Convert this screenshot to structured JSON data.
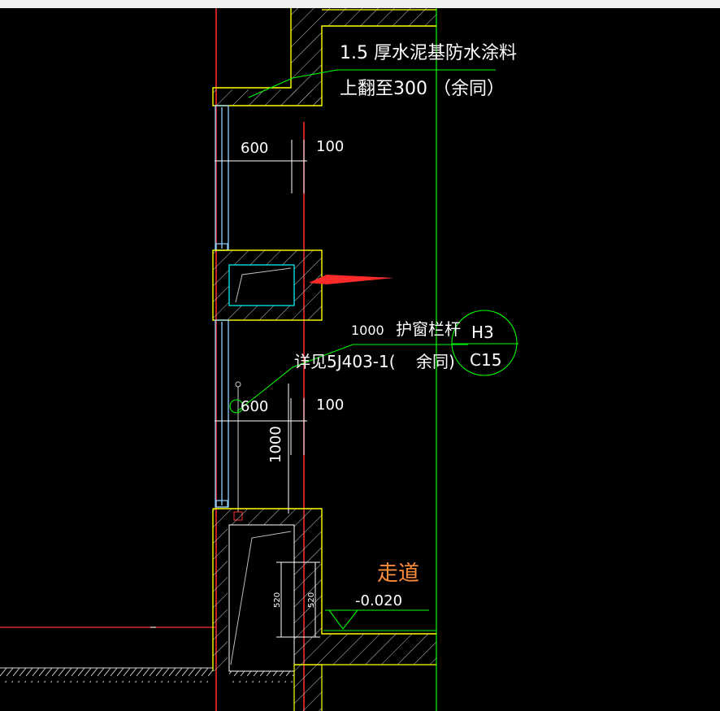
{
  "colors": {
    "background": "#000000",
    "wall": "#ffff00",
    "window": "#8fd0ff",
    "axis": "#ff3030",
    "leader": "#00ff00",
    "inner": "#00ffff",
    "hatch": "#d0d0d0",
    "label_orange": "#ff8c3a",
    "arrow": "#ff2a2a"
  },
  "annotations": {
    "waterproof_line1": "1.5  厚水泥基防水涂料",
    "waterproof_line2": "上翻至300 （余同）",
    "railing_dim": "1000",
    "railing_label": "护窗栏杆",
    "railing_ref": "详见5J403-1(",
    "railing_ref_tail": "余同)"
  },
  "dimensions": {
    "upper_width": "600",
    "upper_edge": "100",
    "lower_width": "600",
    "lower_edge": "100",
    "railing_height": "1000",
    "small_left": "520",
    "small_right": "520"
  },
  "symbol": {
    "top": "H3",
    "bottom": "C15"
  },
  "corridor": {
    "label": "走道",
    "elevation": "-0.020"
  }
}
